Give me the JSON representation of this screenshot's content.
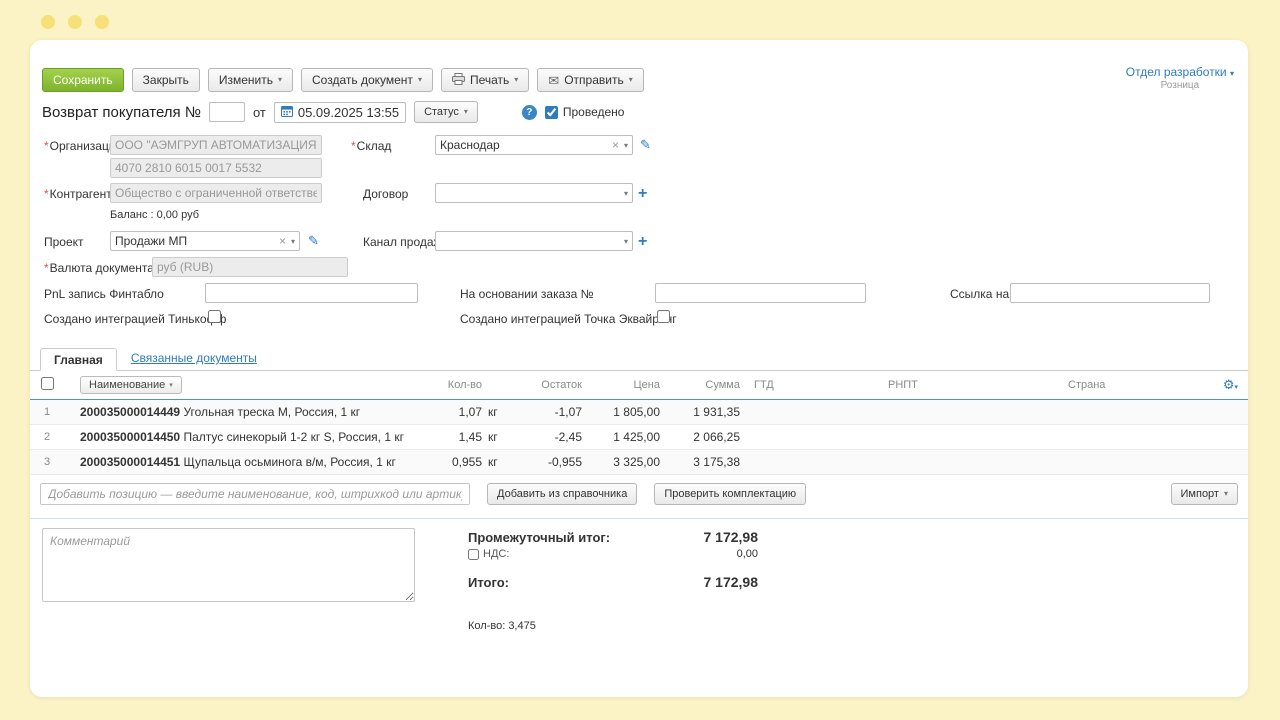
{
  "colors": {
    "background": "#fbf2c6",
    "accent_green": "#7fb32c",
    "accent_blue": "#2e7bbf",
    "required_red": "#d9534f",
    "header_underline": "#4f94cd"
  },
  "icons": {
    "caret": "▾",
    "close_x": "×",
    "pencil": "✎",
    "plus": "+",
    "envelope": "✉",
    "gear": "⚙",
    "question": "?"
  },
  "toolbar": {
    "save": "Сохранить",
    "close": "Закрыть",
    "edit": "Изменить",
    "create_document": "Создать документ",
    "print": "Печать",
    "send": "Отправить",
    "account": "Отдел разработки",
    "account_type": "Розница"
  },
  "doc_header": {
    "title": "Возврат покупателя №",
    "number": "",
    "from_label": "от",
    "date": "05.09.2025 13:55",
    "status_button": "Статус",
    "conducted_label": "Проведено",
    "conducted_checked": true
  },
  "fields": {
    "organization": {
      "label": "Организация",
      "value": "ООО \"АЭМГРУП АВТОМАТИЗАЦИЯ\""
    },
    "org_account": "4070 2810 6015 0017 5532",
    "warehouse": {
      "label": "Склад",
      "value": "Краснодар"
    },
    "counterparty": {
      "label": "Контрагент",
      "value": "Общество с ограниченной ответственность"
    },
    "balance": "Баланс : 0,00 руб",
    "contract": {
      "label": "Договор",
      "value": ""
    },
    "project": {
      "label": "Проект",
      "value": "Продажи МП"
    },
    "sales_channel": {
      "label": "Канал продаж",
      "value": ""
    },
    "currency": {
      "label": "Валюта документа",
      "value": "руб (RUB)"
    },
    "pnl": {
      "label": "PnL запись Финтабло",
      "value": ""
    },
    "order_basis": {
      "label": "На основании заказа №",
      "value": ""
    },
    "order_link": {
      "label": "Ссылка на заказ",
      "value": ""
    },
    "tinkoff": {
      "label": "Создано интеграцией Тинькофф",
      "checked": false
    },
    "tochka": {
      "label": "Создано интеграцией Точка Эквайринг",
      "checked": false
    }
  },
  "tabs": {
    "main": "Главная",
    "related": "Связанные документы"
  },
  "table": {
    "columns": {
      "name": "Наименование",
      "qty": "Кол-во",
      "stock": "Остаток",
      "price": "Цена",
      "sum": "Сумма",
      "gtd": "ГТД",
      "rnpt": "РНПТ",
      "country": "Страна"
    },
    "rows": [
      {
        "num": "1",
        "code": "200035000014449",
        "name": "Угольная треска М, Россия, 1 кг",
        "qty": "1,07",
        "unit": "кг",
        "stock": "-1,07",
        "price": "1 805,00",
        "sum": "1 931,35"
      },
      {
        "num": "2",
        "code": "200035000014450",
        "name": "Палтус синекорый 1-2 кг S, Россия, 1 кг",
        "qty": "1,45",
        "unit": "кг",
        "stock": "-2,45",
        "price": "1 425,00",
        "sum": "2 066,25"
      },
      {
        "num": "3",
        "code": "200035000014451",
        "name": "Щупальца осьминога в/м, Россия, 1 кг",
        "qty": "0,955",
        "unit": "кг",
        "stock": "-0,955",
        "price": "3 325,00",
        "sum": "3 175,38"
      }
    ],
    "add_placeholder": "Добавить позицию — введите наименование, код, штрихкод или артикул",
    "add_from_catalog": "Добавить из справочника",
    "check_assembly": "Проверить комплектацию",
    "import": "Импорт"
  },
  "footer": {
    "comment_placeholder": "Комментарий",
    "subtotal_label": "Промежуточный итог:",
    "subtotal": "7 172,98",
    "vat_label": "НДС:",
    "vat": "0,00",
    "total_label": "Итого:",
    "total": "7 172,98",
    "qty_total": "Кол-во: 3,475"
  }
}
